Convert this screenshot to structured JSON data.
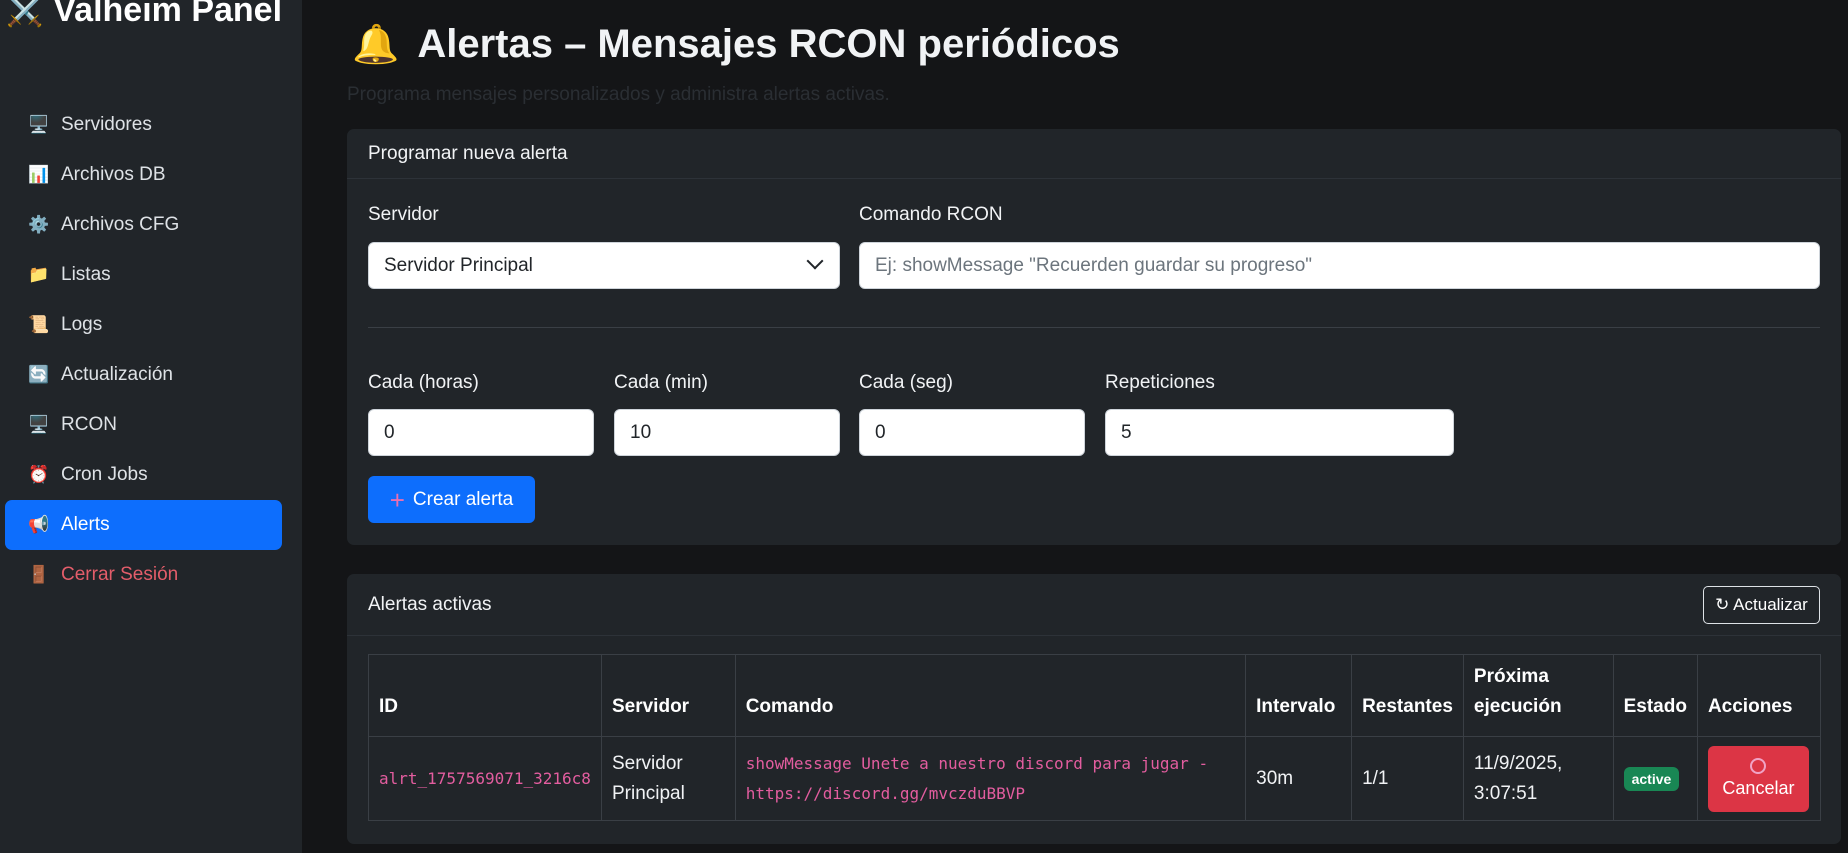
{
  "sidebar": {
    "brand": "Valheim Panel",
    "items": [
      {
        "label": "Servidores",
        "icon": "🖥️"
      },
      {
        "label": "Archivos DB",
        "icon": "📊"
      },
      {
        "label": "Archivos CFG",
        "icon": "⚙️"
      },
      {
        "label": "Listas",
        "icon": "📁"
      },
      {
        "label": "Logs",
        "icon": "📜"
      },
      {
        "label": "Actualización",
        "icon": "🔄"
      },
      {
        "label": "RCON",
        "icon": "🖥️"
      },
      {
        "label": "Cron Jobs",
        "icon": "⏰"
      },
      {
        "label": "Alerts",
        "icon": "📢"
      },
      {
        "label": "Cerrar Sesión",
        "icon": "🚪"
      }
    ]
  },
  "page": {
    "title": "Alertas – Mensajes RCON periódicos",
    "subtitle": "Programa mensajes personalizados y administra alertas activas."
  },
  "form": {
    "header": "Programar nueva alerta",
    "server_label": "Servidor",
    "server_value": "Servidor Principal",
    "command_label": "Comando RCON",
    "command_placeholder": "Ej: showMessage \"Recuerden guardar su progreso\"",
    "hours_label": "Cada (horas)",
    "hours_value": "0",
    "min_label": "Cada (min)",
    "min_value": "10",
    "sec_label": "Cada (seg)",
    "sec_value": "0",
    "reps_label": "Repeticiones",
    "reps_value": "5",
    "create_label": "Crear alerta"
  },
  "active": {
    "header": "Alertas activas",
    "refresh_label": "↻ Actualizar",
    "columns": [
      "ID",
      "Servidor",
      "Comando",
      "Intervalo",
      "Restantes",
      "Próxima ejecución",
      "Estado",
      "Acciones"
    ],
    "rows": [
      {
        "id": "alrt_1757569071_3216c8",
        "server": "Servidor Principal",
        "command": "showMessage Unete a nuestro discord para jugar - https://discord.gg/mvczduBBVP",
        "interval": "30m",
        "remaining": "1/1",
        "next": "11/9/2025, 3:07:51",
        "status": "active",
        "action": "Cancelar"
      }
    ]
  },
  "colors": {
    "accent": "#0d6efd",
    "danger": "#dc3545",
    "success": "#198754",
    "sidebar_bg": "#212529",
    "page_bg": "#141517"
  }
}
